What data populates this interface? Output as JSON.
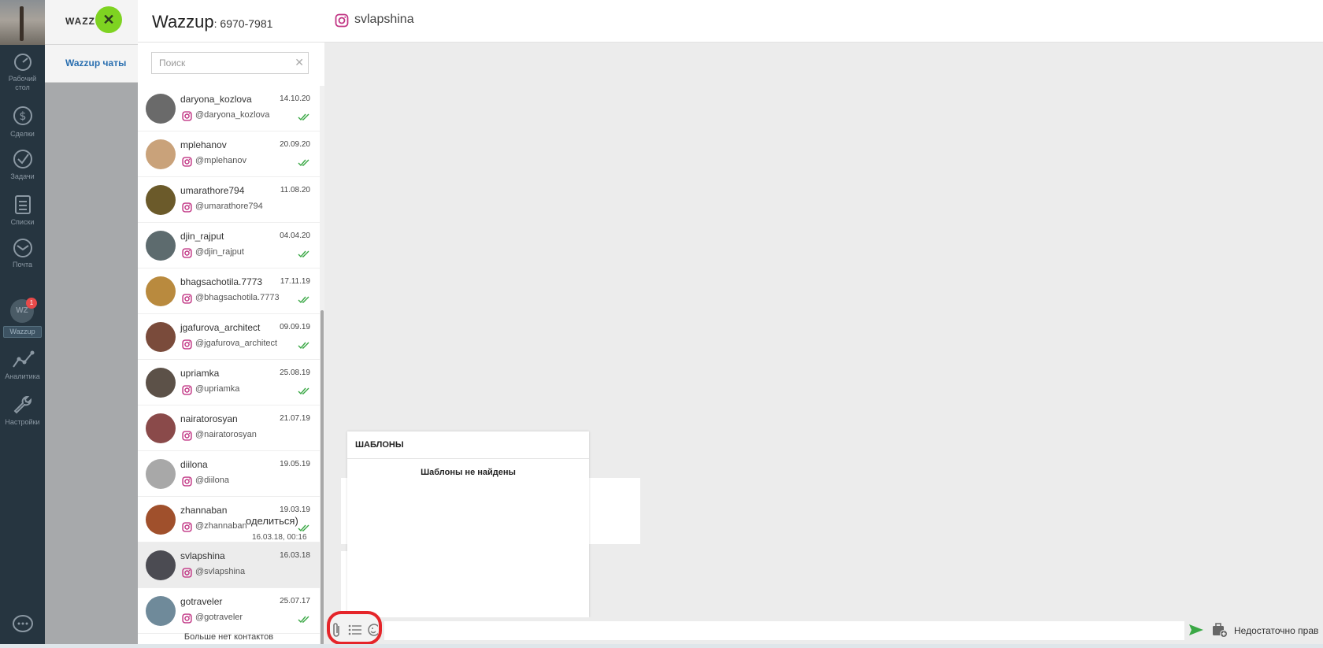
{
  "app": {
    "logo_text": "WAZZ",
    "logo_mark": "✕"
  },
  "rail": {
    "items": [
      {
        "label_line1": "Рабочий",
        "label_line2": "стол",
        "icon": "speedometer-icon"
      },
      {
        "label_line1": "Сделки",
        "label_line2": "",
        "icon": "dollar-icon"
      },
      {
        "label_line1": "Задачи",
        "label_line2": "",
        "icon": "checkmark-icon"
      },
      {
        "label_line1": "Списки",
        "label_line2": "",
        "icon": "list-icon"
      },
      {
        "label_line1": "Почта",
        "label_line2": "",
        "icon": "mail-icon"
      },
      {
        "label_line1": "Аналитика",
        "label_line2": "",
        "icon": "analytics-icon"
      },
      {
        "label_line1": "Настройки",
        "label_line2": "",
        "icon": "wrench-icon"
      }
    ],
    "wazzup": {
      "circle_text": "WZ",
      "badge": "1",
      "label": "Wazzup"
    }
  },
  "subnav": {
    "label": "Wazzup чаты"
  },
  "header": {
    "title": "Wazzup",
    "phone": ": 6970-7981",
    "contact": "svlapshina"
  },
  "search": {
    "placeholder": "Поиск",
    "value": ""
  },
  "contacts": [
    {
      "name": "daryona_kozlova",
      "date": "14.10.20",
      "handle": "@daryona_kozlova",
      "read": true,
      "avatar_color": "#6a6a6a"
    },
    {
      "name": "mplehanov",
      "date": "20.09.20",
      "handle": "@mplehanov",
      "read": true,
      "avatar_color": "#c9a27a"
    },
    {
      "name": "umarathore794",
      "date": "11.08.20",
      "handle": "@umarathore794",
      "read": false,
      "avatar_color": "#6b5a2a"
    },
    {
      "name": "djin_rajput",
      "date": "04.04.20",
      "handle": "@djin_rajput",
      "read": true,
      "avatar_color": "#5d6b6e"
    },
    {
      "name": "bhagsachotila.7773",
      "date": "17.11.19",
      "handle": "@bhagsachotila.7773",
      "read": true,
      "avatar_color": "#b98a3e"
    },
    {
      "name": "jgafurova_architect",
      "date": "09.09.19",
      "handle": "@jgafurova_architect",
      "read": true,
      "avatar_color": "#7a4b3b"
    },
    {
      "name": "upriamka",
      "date": "25.08.19",
      "handle": "@upriamka",
      "read": true,
      "avatar_color": "#5c5148"
    },
    {
      "name": "nairatorosyan",
      "date": "21.07.19",
      "handle": "@nairatorosyan",
      "read": false,
      "avatar_color": "#8a4a4a"
    },
    {
      "name": "diilona",
      "date": "19.05.19",
      "handle": "@diilona",
      "read": false,
      "avatar_color": "#a8a8a8"
    },
    {
      "name": "zhannaban",
      "date": "19.03.19",
      "handle": "@zhannaban",
      "read": true,
      "avatar_color": "#a0502c"
    },
    {
      "name": "svlapshina",
      "date": "16.03.18",
      "handle": "@svlapshina",
      "read": false,
      "avatar_color": "#4b4b52",
      "active": true
    },
    {
      "name": "gotraveler",
      "date": "25.07.17",
      "handle": "@gotraveler",
      "read": true,
      "avatar_color": "#6f8a9a"
    }
  ],
  "no_more_contacts": "Больше нет контактов",
  "message": {
    "text_fragment": "оделиться)",
    "time": "16.03.18, 00:16"
  },
  "templates": {
    "title": "ШАБЛОНЫ",
    "empty": "Шаблоны не найдены"
  },
  "composer": {
    "placeholder": "",
    "no_permission": "Недостаточно прав"
  },
  "colors": {
    "rail_bg": "#263540",
    "accent_blue": "#2a6fb0",
    "logo_green": "#7ed321",
    "instagram": "#c13584",
    "check_green": "#3aa845",
    "highlight_red": "#e5252a"
  }
}
